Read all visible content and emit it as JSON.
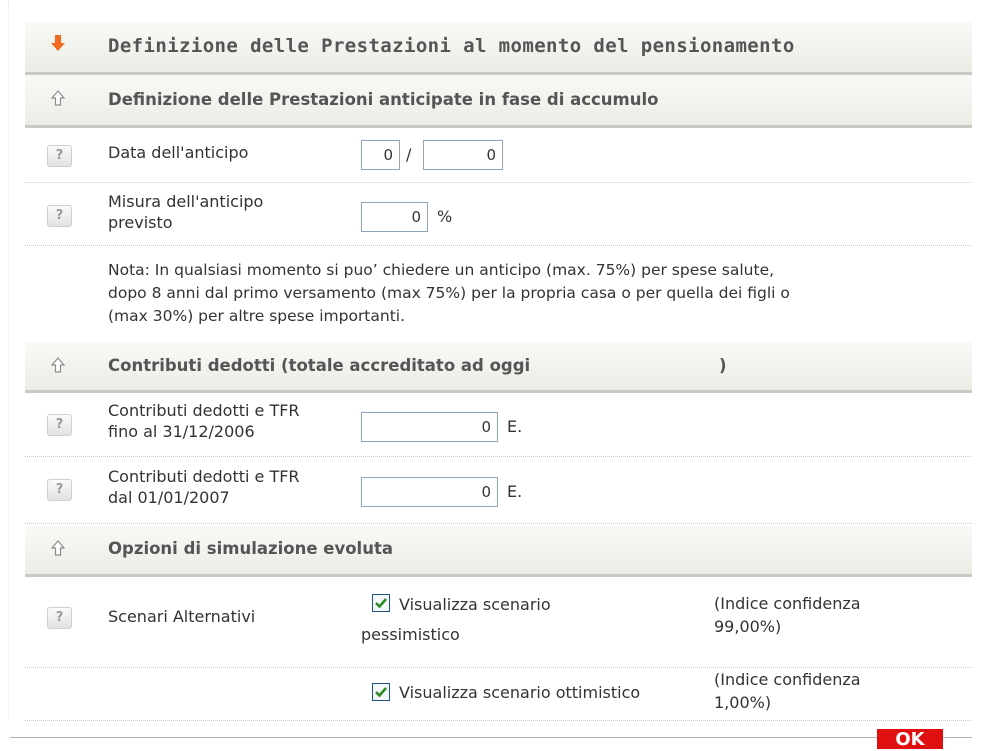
{
  "sections": {
    "main_header": "Definizione delle Prestazioni al momento del pensionamento",
    "anticipate_header": "Definizione delle Prestazioni anticipate in fase di accumulo",
    "contributi_header": "Contributi dedotti (totale accreditato ad oggi",
    "contributi_header_close": ")",
    "opzioni_header": "Opzioni di simulazione evoluta"
  },
  "anticipo": {
    "data_label": "Data dell'anticipo",
    "data_month": "0",
    "data_separator": "/",
    "data_year": "0",
    "misura_label_line1": "Misura dell'anticipo",
    "misura_label_line2": "previsto",
    "misura_value": "0",
    "misura_unit": "%"
  },
  "note": {
    "line1": "Nota: In qualsiasi momento si puo’ chiedere un anticipo (max. 75%) per spese salute,",
    "line2": "dopo 8 anni dal primo versamento (max 75%) per la propria casa o per quella dei figli o",
    "line3": "(max 30%) per altre spese importanti."
  },
  "contributi": {
    "fino_label_line1": "Contributi dedotti e TFR",
    "fino_label_line2": "fino al 31/12/2006",
    "fino_value": "0",
    "fino_unit": "E.",
    "dal_label_line1": "Contributi dedotti e TFR",
    "dal_label_line2": "dal 01/01/2007",
    "dal_value": "0",
    "dal_unit": "E."
  },
  "scenari": {
    "label": "Scenari Alternativi",
    "pessimistico_line1": "Visualizza scenario",
    "pessimistico_line2": "pessimistico",
    "pessimistico_checked": true,
    "pessimistico_conf_line1": "(Indice confidenza",
    "pessimistico_conf_line2": "99,00%)",
    "ottimistico_text": "Visualizza scenario ottimistico",
    "ottimistico_checked": true,
    "ottimistico_conf_line1": "(Indice confidenza",
    "ottimistico_conf_line2": "1,00%)"
  },
  "help_glyph": "?",
  "ok_label": "OK",
  "icons": {
    "main": "orange-down-arrow-icon",
    "sub": "gray-up-arrow-icon",
    "help": "help-icon",
    "check": "checkmark-icon"
  },
  "colors": {
    "accent_orange": "#f26a1b",
    "ok_red": "#e01010",
    "check_green": "#2e8b22",
    "input_border": "#8ea5bd"
  }
}
